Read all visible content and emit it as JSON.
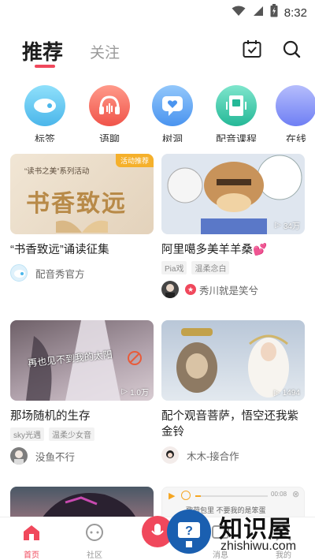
{
  "status": {
    "time": "8:32"
  },
  "header": {
    "tab_active": "推荐",
    "tab_inactive": "关注"
  },
  "categories": [
    {
      "label": "标签",
      "color": "#5bc4ee"
    },
    {
      "label": "语聊",
      "color": "#f26a5f"
    },
    {
      "label": "树洞",
      "color": "#5aa6f4"
    },
    {
      "label": "配音课程",
      "color": "#39c7a7"
    },
    {
      "label": "在线",
      "color": "#7f8ef7"
    }
  ],
  "cards": [
    {
      "title": "“书香致远”诵读征集",
      "badge": "活动推荐",
      "banner_small": "“读书之美”系列活动",
      "banner_big": "书香致远",
      "tags": [],
      "author": "配音秀官方",
      "plays": ""
    },
    {
      "title": "阿里噶多美羊羊桑💕",
      "badge": "",
      "tags": [
        "Pia戏",
        "温柔念白"
      ],
      "author": "秀川就是笑兮",
      "plays": "34万"
    },
    {
      "title": "那场随机的生存",
      "badge": "",
      "thumb_text": "再也见不到我的太阳",
      "tags": [
        "sky光遇",
        "温柔少女音"
      ],
      "author": "没鱼不行",
      "plays": "1.0万"
    },
    {
      "title": "配个观音菩萨，悟空还我紫金铃",
      "badge": "",
      "tags": [],
      "author": "木木-接合作",
      "plays": "1494"
    }
  ],
  "partial_card": {
    "audio_time": "00:08",
    "caption": "歌荷包里  不要我的是笨蛋"
  },
  "bottom_nav": {
    "home": "首页",
    "community": "社区",
    "messages": "消息",
    "mine": "我的"
  },
  "watermark": {
    "text": "知识屋",
    "url": "zhishiwu.com"
  },
  "colors": {
    "accent": "#f0485c"
  }
}
